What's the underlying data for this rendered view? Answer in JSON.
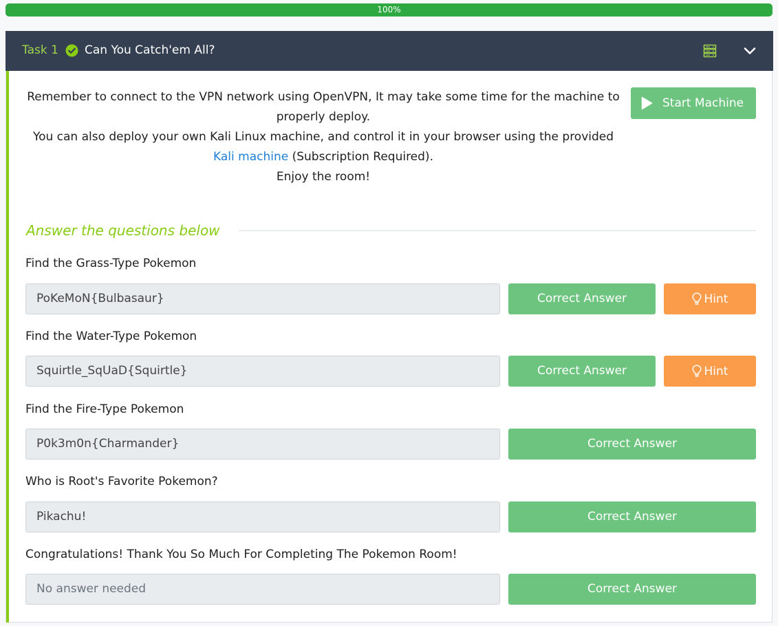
{
  "progress": {
    "label": "100%",
    "value": 1.0
  },
  "task": {
    "number_label": "Task 1",
    "title": "Can You Catch'em All?",
    "icons": [
      "check-circle-icon",
      "server-icon",
      "chevron-down-icon"
    ]
  },
  "description": {
    "line1": "Remember to connect to the VPN network using OpenVPN, It may take some time for the machine to properly deploy.",
    "line2_before": "You can also deploy your own Kali Linux machine, and control it in your browser using the provided ",
    "line2_link": "Kali machine",
    "line2_after": " (Subscription Required).",
    "line3": "Enjoy the room!"
  },
  "start_machine": {
    "label": "Start Machine"
  },
  "answers_heading": "Answer the questions below",
  "questions": [
    {
      "label": "Find the Grass-Type Pokemon",
      "value": "PoKeMoN{Bulbasaur}",
      "button": "Correct Answer",
      "hint": "Hint"
    },
    {
      "label": "Find the Water-Type Pokemon",
      "value": "Squirtle_SqUaD{Squirtle}",
      "button": "Correct Answer",
      "hint": "Hint"
    },
    {
      "label": "Find the Fire-Type Pokemon",
      "value": "P0k3m0n{Charmander}",
      "button": "Correct Answer"
    },
    {
      "label": "Who is Root's Favorite Pokemon?",
      "value": "Pikachu!",
      "button": "Correct Answer"
    },
    {
      "label": "Congratulations! Thank You So Much For Completing The Pokemon Room!",
      "placeholder": "No answer needed",
      "button": "Correct Answer"
    }
  ],
  "colors": {
    "header_bg": "#343f52",
    "accent_green": "#88cc14",
    "button_green": "#6dc47f",
    "hint_orange": "#fb9c4b",
    "progress_green": "#2ea841",
    "link_blue": "#1e7fd6"
  }
}
